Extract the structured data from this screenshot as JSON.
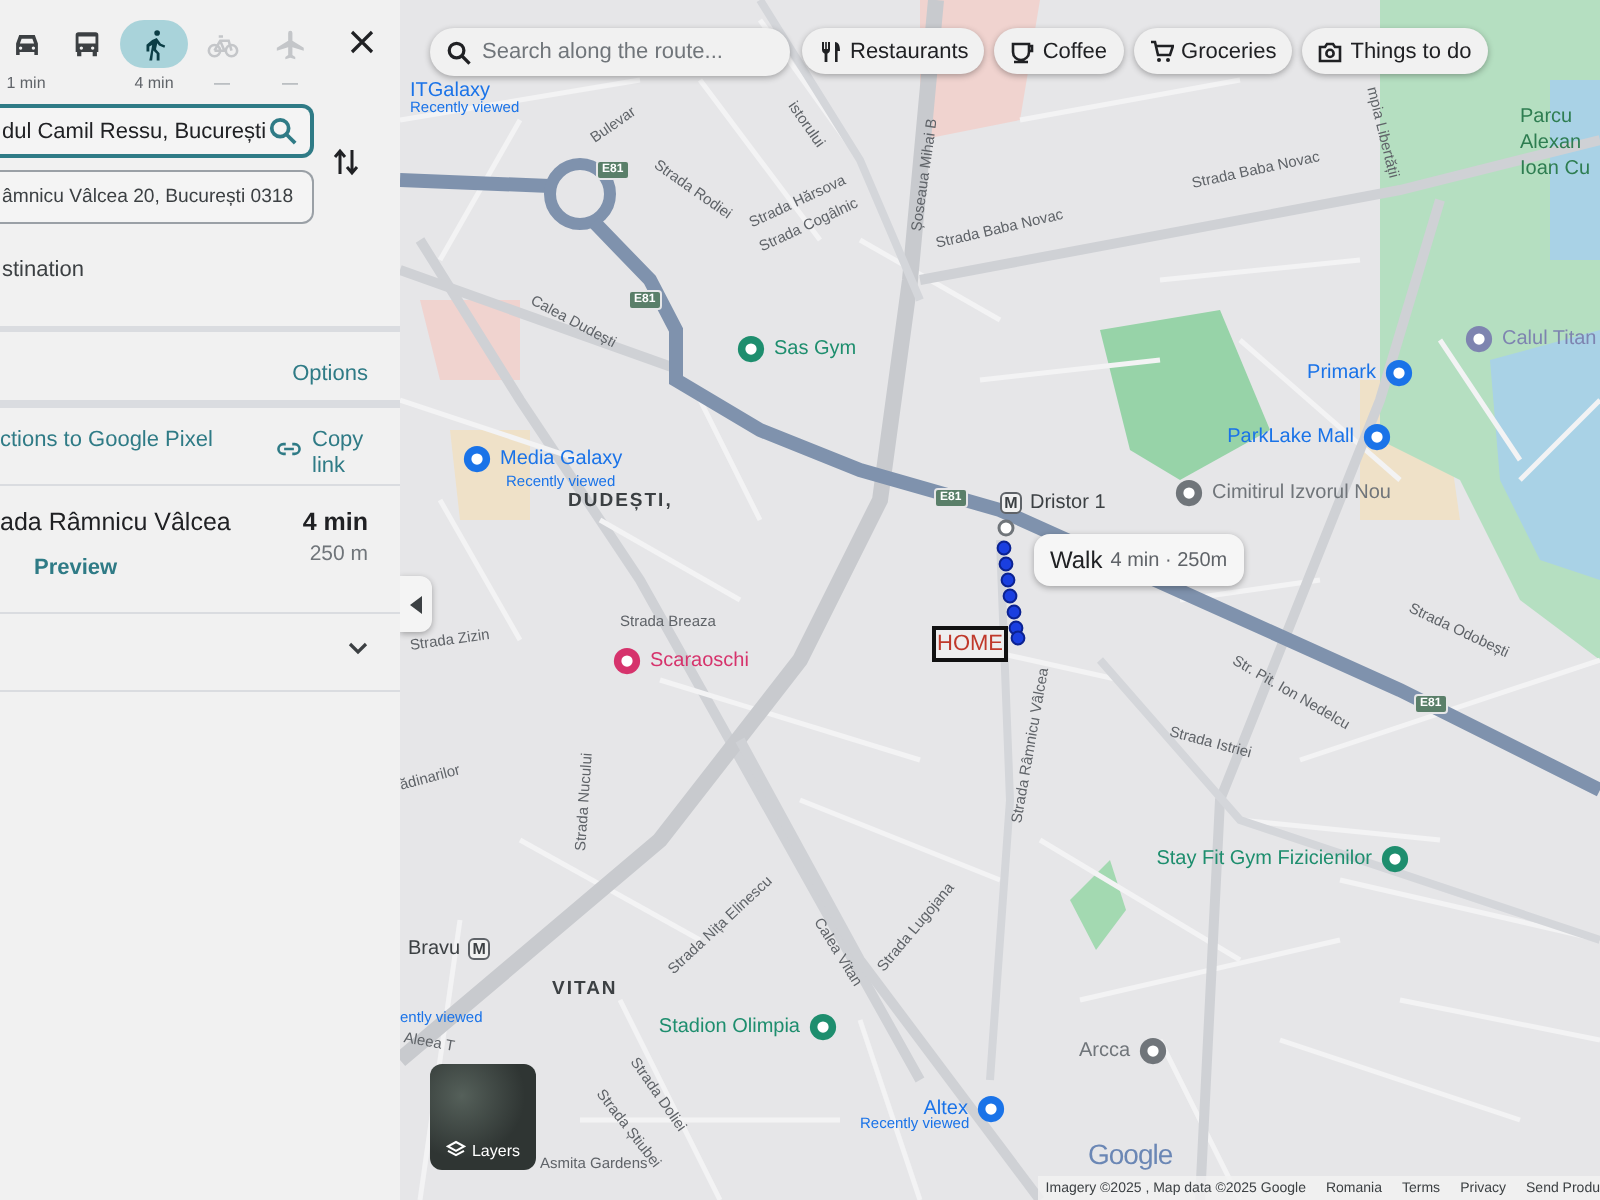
{
  "sidebar": {
    "modes": [
      {
        "kind": "car",
        "time": "1 min",
        "selected": false,
        "disabled": false
      },
      {
        "kind": "transit",
        "selected": false,
        "disabled": false
      },
      {
        "kind": "walk",
        "time": "4 min",
        "selected": true,
        "disabled": false
      },
      {
        "kind": "bike",
        "time": "—",
        "selected": false,
        "disabled": true
      },
      {
        "kind": "flight",
        "time": "—",
        "selected": false,
        "disabled": true
      }
    ],
    "origin": {
      "value": "dul Camil Ressu, București",
      "focused": true
    },
    "destination": {
      "value": "âmnicu Vâlcea 20, București 0318",
      "focused": false
    },
    "add_destination": "stination",
    "options": "Options",
    "send_link": "ctions to Google Pixel",
    "copy_link": "Copy link",
    "route": {
      "name": "ada Râmnicu Vâlcea",
      "time": "4 min",
      "distance": "250 m",
      "preview": "Preview"
    }
  },
  "map": {
    "search": {
      "placeholder": "Search along the route..."
    },
    "chips": [
      {
        "kind": "restaurant",
        "label": "Restaurants"
      },
      {
        "kind": "coffee",
        "label": "Coffee"
      },
      {
        "kind": "groceries",
        "label": "Groceries"
      },
      {
        "kind": "camera",
        "label": "Things to do"
      }
    ],
    "labels": [
      {
        "kind": "place",
        "text": "ITGalaxy"
      },
      {
        "kind": "note",
        "text": "Recently viewed"
      },
      {
        "kind": "street",
        "text": "istorului"
      },
      {
        "kind": "street",
        "text": "Bulevar"
      },
      {
        "kind": "street",
        "text": "Strada Rodiei"
      },
      {
        "kind": "street",
        "text": "Strada Hărsova"
      },
      {
        "kind": "street",
        "text": "Strada Cogâlnic"
      },
      {
        "kind": "street",
        "text": "Șoseaua Mihai B"
      },
      {
        "kind": "street",
        "text": "Strada Baba Novac"
      },
      {
        "kind": "street",
        "text": "Strada Baba Novac"
      },
      {
        "kind": "street",
        "text": "mpia Libertății"
      },
      {
        "kind": "street",
        "text": "Calea Dudești"
      },
      {
        "kind": "poi",
        "text": "Sas Gym",
        "color": "#1e8e6e"
      },
      {
        "kind": "poi",
        "text": "Media Galaxy",
        "color": "#1a73e8"
      },
      {
        "kind": "note",
        "text": "Recently viewed"
      },
      {
        "kind": "area",
        "text": "DUDEȘTI,"
      },
      {
        "kind": "metro",
        "text": "Dristor 1",
        "badge": "M"
      },
      {
        "kind": "poi",
        "text": "Primark",
        "color": "#1a73e8"
      },
      {
        "kind": "poi",
        "text": "ParkLake Mall",
        "color": "#1a73e8"
      },
      {
        "kind": "poi",
        "text": "Cimitirul Izvorul Nou",
        "color": "#70757a"
      },
      {
        "kind": "park",
        "text": "Parcu"
      },
      {
        "kind": "park",
        "text": "Alexan"
      },
      {
        "kind": "park",
        "text": "Ioan Cu"
      },
      {
        "kind": "poi",
        "text": "Calul Titan",
        "color": "#7e84b0"
      },
      {
        "kind": "street",
        "text": "Strada Breaza"
      },
      {
        "kind": "street",
        "text": "Strada Zizin"
      },
      {
        "kind": "poi",
        "text": "Scaraoschi",
        "color": "#d6336c"
      },
      {
        "kind": "street",
        "text": "Strada Odobești"
      },
      {
        "kind": "street",
        "text": "Str. Pit. Ion Nedelcu"
      },
      {
        "kind": "street",
        "text": "Strada Istriei"
      },
      {
        "kind": "street",
        "text": "Strada Râmnicu Vâlcea"
      },
      {
        "kind": "street",
        "text": "Strada Nucului"
      },
      {
        "kind": "street",
        "text": "ădinarilor"
      },
      {
        "kind": "poi",
        "text": "Stay Fit Gym Fizicienilor",
        "color": "#1e8e6e"
      },
      {
        "kind": "street",
        "text": "Strada Lugojana"
      },
      {
        "kind": "street",
        "text": "Strada Nița Elinescu"
      },
      {
        "kind": "street",
        "text": "Calea Vitan"
      },
      {
        "kind": "metro",
        "text": "Bravu",
        "badge": "M"
      },
      {
        "kind": "area",
        "text": "VITAN"
      },
      {
        "kind": "note",
        "text": "ently viewed"
      },
      {
        "kind": "street",
        "text": "Aleea T"
      },
      {
        "kind": "poi",
        "text": "Stadion Olimpia",
        "color": "#1e8e6e"
      },
      {
        "kind": "street",
        "text": "Strada Doliei"
      },
      {
        "kind": "street",
        "text": "Strada Știubei"
      },
      {
        "kind": "poi",
        "text": "Arcca",
        "color": "#70757a"
      },
      {
        "kind": "poi",
        "text": "Altex",
        "color": "#1a73e8"
      },
      {
        "kind": "note",
        "text": "Recently viewed"
      },
      {
        "kind": "street",
        "text": "Asmita Gardens"
      }
    ],
    "shields": [
      "E81",
      "E81",
      "E81",
      "E81"
    ],
    "route_tooltip": {
      "mode": "Walk",
      "detail": "4 min · 250m"
    },
    "marker": "HOME",
    "layers": "Layers",
    "logo": "Google",
    "footer": [
      "Imagery ©2025 , Map data ©2025 Google",
      "Romania",
      "Terms",
      "Privacy",
      "Send Produ"
    ]
  }
}
